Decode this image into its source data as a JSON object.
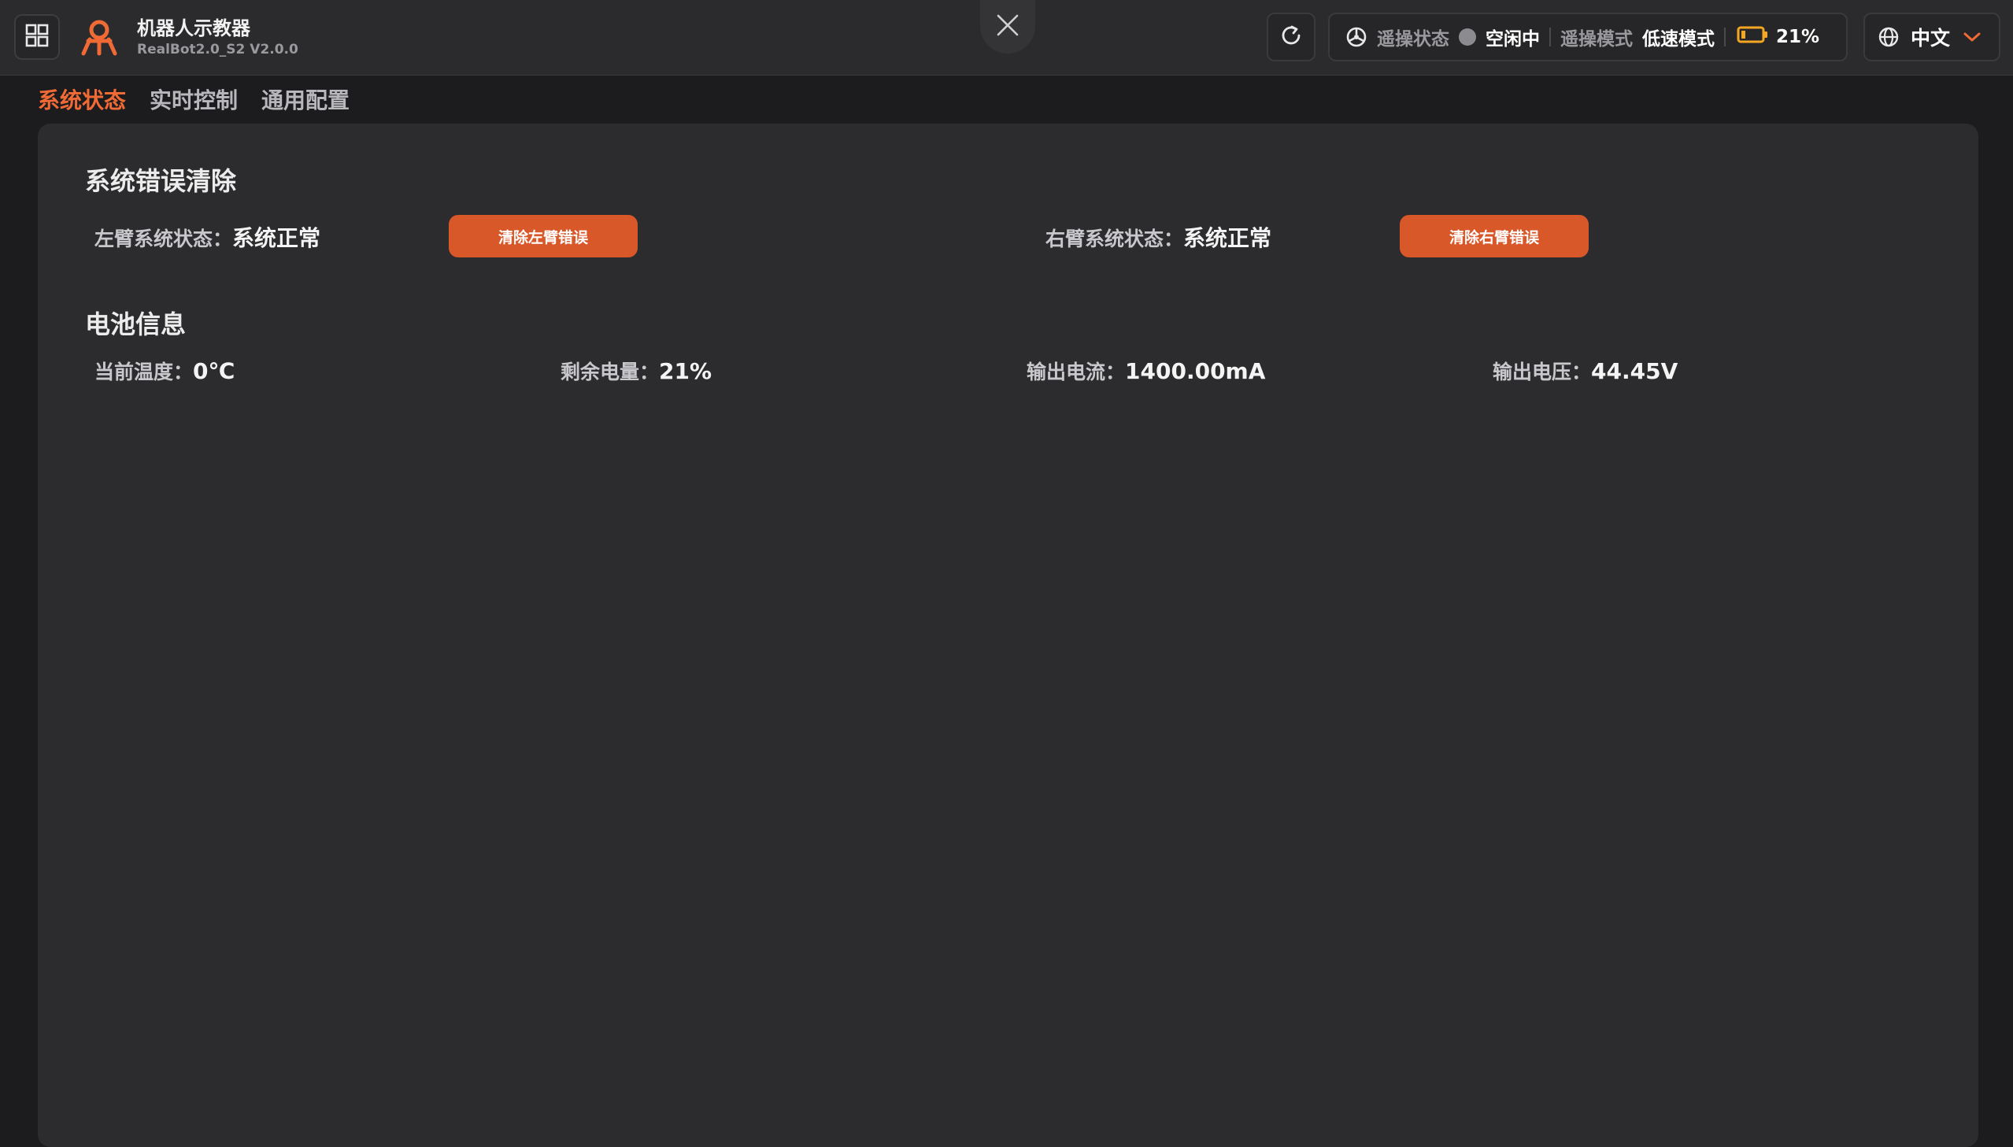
{
  "app": {
    "name": "机器人示教器",
    "version": "RealBot2.0_S2 V2.0.0"
  },
  "header": {
    "teleop_status_label": "遥操状态",
    "teleop_status_value": "空闲中",
    "teleop_mode_label": "遥操模式",
    "teleop_mode_value": "低速模式",
    "battery_percent": "21%",
    "battery_level": 0.21,
    "language": "中文",
    "icons": {
      "grid": "grid-icon",
      "logo": "robot-logo",
      "close": "close-icon",
      "refresh": "refresh-icon",
      "teleop": "steering-wheel-icon",
      "status_dot": "status-dot",
      "battery": "battery-icon",
      "globe": "globe-icon",
      "chevron": "chevron-down-icon"
    }
  },
  "tabs": [
    {
      "label": "系统状态",
      "active": true
    },
    {
      "label": "实时控制",
      "active": false
    },
    {
      "label": "通用配置",
      "active": false
    }
  ],
  "error_section": {
    "title": "系统错误清除",
    "left_arm_label": "左臂系统状态：",
    "left_arm_value": "系统正常",
    "clear_left_button": "清除左臂错误",
    "right_arm_label": "右臂系统状态：",
    "right_arm_value": "系统正常",
    "clear_right_button": "清除右臂错误"
  },
  "battery_section": {
    "title": "电池信息",
    "temperature_label": "当前温度：",
    "temperature_value": "0℃",
    "remaining_label": "剩余电量：",
    "remaining_value": "21%",
    "current_label": "输出电流：",
    "current_value": "1400.00mA",
    "voltage_label": "输出电压：",
    "voltage_value": "44.45V"
  },
  "colors": {
    "accent": "#f06a35",
    "button": "#d9582a",
    "battery": "#f5a623",
    "background": "#1c1c1e",
    "panel": "#2c2c2e"
  }
}
